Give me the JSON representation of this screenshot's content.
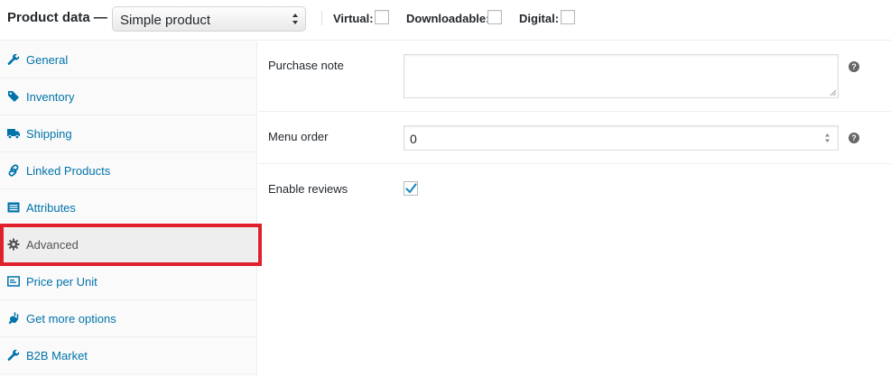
{
  "header": {
    "title": "Product data —",
    "product_type": {
      "selected": "Simple product",
      "icon": "select-arrows-icon"
    },
    "options": [
      {
        "label": "Virtual:",
        "checked": false
      },
      {
        "label": "Downloadable:",
        "checked": false
      },
      {
        "label": "Digital:",
        "checked": false
      }
    ]
  },
  "sidebar": {
    "active": "Advanced",
    "link_color": "#0073aa",
    "highlight_color": "#e0202a",
    "items": [
      {
        "label": "General",
        "icon": "wrench-icon"
      },
      {
        "label": "Inventory",
        "icon": "tag-icon"
      },
      {
        "label": "Shipping",
        "icon": "truck-icon"
      },
      {
        "label": "Linked Products",
        "icon": "link-icon"
      },
      {
        "label": "Attributes",
        "icon": "list-icon"
      },
      {
        "label": "Advanced",
        "icon": "gear-icon"
      },
      {
        "label": "Price per Unit",
        "icon": "price-tag-icon"
      },
      {
        "label": "Get more options",
        "icon": "plugin-icon"
      },
      {
        "label": "B2B Market",
        "icon": "wrench-icon"
      }
    ]
  },
  "main": {
    "purchase_note": {
      "label": "Purchase note",
      "value": ""
    },
    "menu_order": {
      "label": "Menu order",
      "value": "0"
    },
    "enable_reviews": {
      "label": "Enable reviews",
      "checked": true
    }
  }
}
